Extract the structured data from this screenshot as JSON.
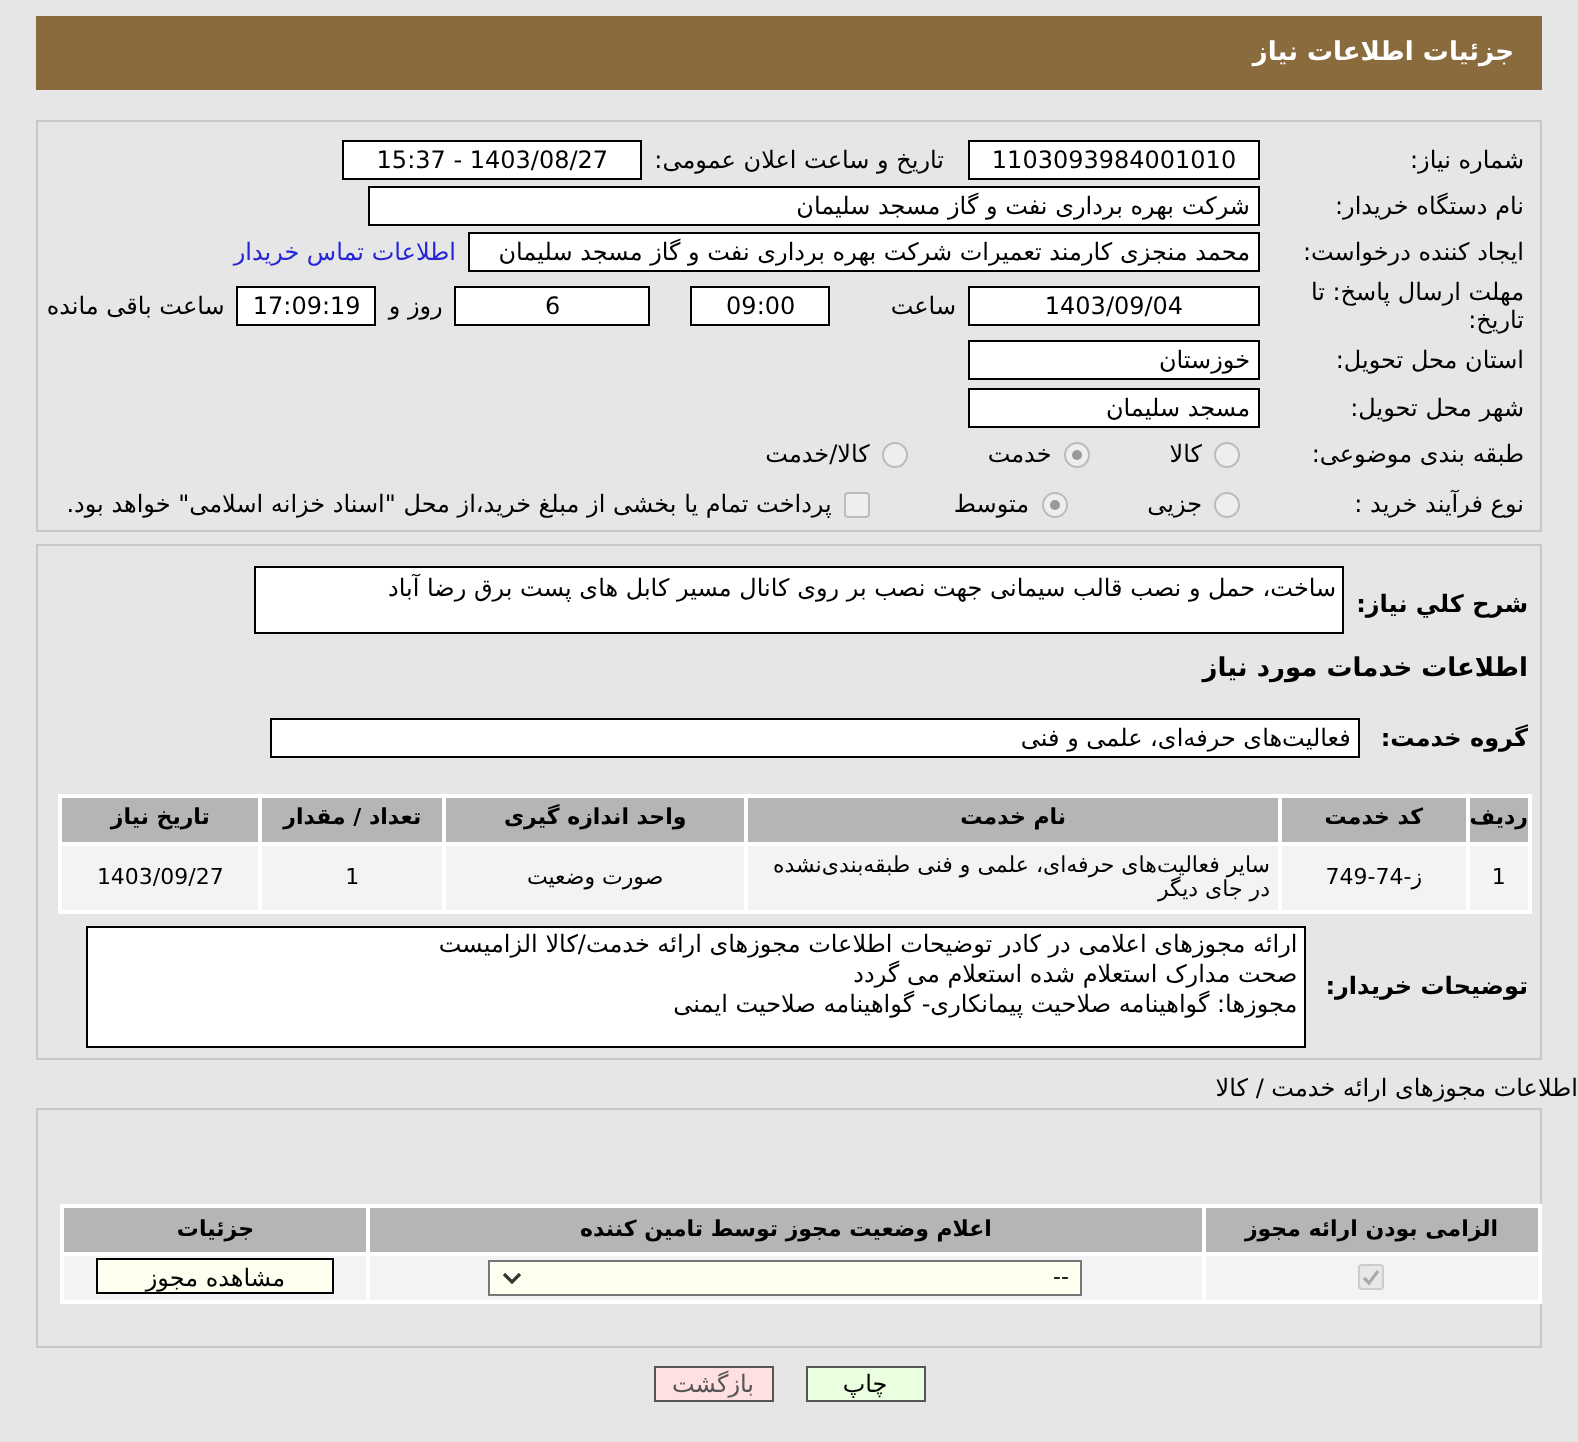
{
  "header": {
    "title": "جزئیات اطلاعات نیاز"
  },
  "details": {
    "need_number": {
      "label": "شماره نیاز:",
      "value": "1103093984001010"
    },
    "announce": {
      "label": "تاریخ و ساعت اعلان عمومی:",
      "value": "1403/08/27 - 15:37"
    },
    "buyer": {
      "label": "نام دستگاه خریدار:",
      "value": "شرکت بهره برداری نفت و گاز مسجد سلیمان"
    },
    "requester": {
      "label": "ایجاد کننده درخواست:",
      "value": "محمد منجزی کارمند تعمیرات شرکت بهره برداری نفت و گاز مسجد سلیمان",
      "link": "اطلاعات تماس خریدار"
    },
    "deadline": {
      "label": "مهلت ارسال پاسخ: تا تاریخ:",
      "date": "1403/09/04",
      "time_label": "ساعت",
      "time": "09:00",
      "days": "6",
      "days_label": "روز و",
      "remaining": "17:09:19",
      "remaining_label": "ساعت باقی مانده"
    },
    "province": {
      "label": "استان محل تحویل:",
      "value": "خوزستان"
    },
    "city": {
      "label": "شهر محل تحویل:",
      "value": "مسجد سلیمان"
    },
    "category": {
      "label": "طبقه بندی موضوعی:",
      "options": [
        {
          "label": "کالا",
          "selected": false
        },
        {
          "label": "خدمت",
          "selected": true
        },
        {
          "label": "کالا/خدمت",
          "selected": false
        }
      ]
    },
    "process": {
      "label": "نوع فرآیند خرید :",
      "options": [
        {
          "label": "جزیی",
          "selected": false
        },
        {
          "label": "متوسط",
          "selected": true
        }
      ],
      "payment": {
        "label": "پرداخت تمام یا بخشی از مبلغ خرید،از محل \"اسناد خزانه اسلامی\" خواهد بود.",
        "checked": false
      }
    }
  },
  "services": {
    "description": {
      "label": "شرح کلي نياز:",
      "value": "ساخت، حمل و نصب قالب سیمانی جهت نصب بر روی کانال مسیر کابل های پست برق رضا آباد"
    },
    "heading": "اطلاعات خدمات مورد نیاز",
    "group": {
      "label": "گروه خدمت:",
      "value": "فعالیت‌های حرفه‌ای، علمی و فنی"
    },
    "table": {
      "columns": [
        "ردیف",
        "کد خدمت",
        "نام خدمت",
        "واحد اندازه گیری",
        "تعداد / مقدار",
        "تاریخ نیاز"
      ],
      "rows": [
        [
          "1",
          "ز-74-749",
          "سایر فعالیت‌های حرفه‌ای، علمی و فنی طبقه‌بندی‌نشده در جای دیگر",
          "صورت وضعیت",
          "1",
          "1403/09/27"
        ]
      ]
    },
    "notes": {
      "label": "توضیحات خریدار:",
      "lines": [
        "ارائه مجوزهای اعلامی در کادر توضیحات اطلاعات مجوزهای ارائه خدمت/کالا الزامیست",
        "صحت مدارک استعلام شده استعلام می گردد",
        "مجوزها: گواهینامه صلاحیت پیمانکاری- گواهینامه صلاحیت ایمنی"
      ]
    }
  },
  "permits": {
    "heading": "اطلاعات مجوزهای ارائه خدمت / کالا",
    "columns": [
      "الزامی بودن ارائه مجوز",
      "اعلام وضعیت مجوز توسط تامین کننده",
      "جزئیات"
    ],
    "rows": [
      {
        "required": true,
        "status": "--",
        "button": "مشاهده مجوز"
      }
    ]
  },
  "buttons": [
    {
      "label": "چاپ",
      "kind": "print"
    },
    {
      "label": "بازگشت",
      "kind": "back"
    }
  ]
}
